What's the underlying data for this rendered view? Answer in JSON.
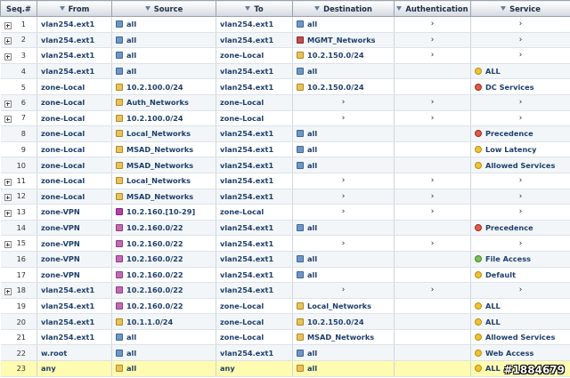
{
  "columns": {
    "seq": "Seq.#",
    "from": "From",
    "source": "Source",
    "to": "To",
    "destination": "Destination",
    "authentication": "Authentication",
    "service": "Service"
  },
  "rows": [
    {
      "seq": "1",
      "expandable": true,
      "from": "vlan254.ext1",
      "source": {
        "icon": "address",
        "text": "all"
      },
      "to": "vlan254.ext1",
      "destination": {
        "icon": "address",
        "text": "all"
      },
      "auth": "›",
      "service": {
        "icon": "",
        "text": "›"
      }
    },
    {
      "seq": "2",
      "expandable": true,
      "from": "vlan254.ext1",
      "source": {
        "icon": "address",
        "text": "all"
      },
      "to": "vlan254.ext1",
      "destination": {
        "icon": "mgmt",
        "text": "MGMT_Networks"
      },
      "auth": "›",
      "service": {
        "icon": "",
        "text": "›"
      }
    },
    {
      "seq": "3",
      "expandable": true,
      "from": "vlan254.ext1",
      "source": {
        "icon": "address",
        "text": "all"
      },
      "to": "zone-Local",
      "destination": {
        "icon": "group",
        "text": "10.2.150.0/24"
      },
      "auth": "›",
      "service": {
        "icon": "",
        "text": "›"
      }
    },
    {
      "seq": "4",
      "expandable": false,
      "from": "vlan254.ext1",
      "source": {
        "icon": "address",
        "text": "all"
      },
      "to": "vlan254.ext1",
      "destination": {
        "icon": "address",
        "text": "all"
      },
      "auth": "",
      "service": {
        "icon": "service",
        "text": "ALL"
      }
    },
    {
      "seq": "5",
      "expandable": false,
      "from": "zone-Local",
      "source": {
        "icon": "group",
        "text": "10.2.100.0/24"
      },
      "to": "vlan254.ext1",
      "destination": {
        "icon": "group",
        "text": "10.2.150.0/24"
      },
      "auth": "",
      "service": {
        "icon": "service-red",
        "text": "DC Services"
      }
    },
    {
      "seq": "6",
      "expandable": true,
      "from": "zone-Local",
      "source": {
        "icon": "group",
        "text": "Auth_Networks"
      },
      "to": "zone-Local",
      "destination": {
        "icon": "",
        "text": "›"
      },
      "auth": "›",
      "service": {
        "icon": "",
        "text": "›"
      }
    },
    {
      "seq": "7",
      "expandable": true,
      "from": "zone-Local",
      "source": {
        "icon": "group",
        "text": "10.2.100.0/24"
      },
      "to": "zone-Local",
      "destination": {
        "icon": "",
        "text": "›"
      },
      "auth": "›",
      "service": {
        "icon": "",
        "text": "›"
      }
    },
    {
      "seq": "8",
      "expandable": false,
      "from": "zone-Local",
      "source": {
        "icon": "group",
        "text": "Local_Networks"
      },
      "to": "vlan254.ext1",
      "destination": {
        "icon": "address",
        "text": "all"
      },
      "auth": "",
      "service": {
        "icon": "service-red",
        "text": "Precedence"
      }
    },
    {
      "seq": "9",
      "expandable": false,
      "from": "zone-Local",
      "source": {
        "icon": "group",
        "text": "MSAD_Networks"
      },
      "to": "vlan254.ext1",
      "destination": {
        "icon": "address",
        "text": "all"
      },
      "auth": "",
      "service": {
        "icon": "service",
        "text": "Low Latency"
      }
    },
    {
      "seq": "10",
      "expandable": false,
      "from": "zone-Local",
      "source": {
        "icon": "group",
        "text": "MSAD_Networks"
      },
      "to": "vlan254.ext1",
      "destination": {
        "icon": "address",
        "text": "all"
      },
      "auth": "",
      "service": {
        "icon": "service",
        "text": "Allowed Services"
      }
    },
    {
      "seq": "11",
      "expandable": true,
      "from": "zone-Local",
      "source": {
        "icon": "group",
        "text": "Local_Networks"
      },
      "to": "vlan254.ext1",
      "destination": {
        "icon": "",
        "text": "›"
      },
      "auth": "›",
      "service": {
        "icon": "",
        "text": "›"
      }
    },
    {
      "seq": "12",
      "expandable": true,
      "from": "zone-Local",
      "source": {
        "icon": "group",
        "text": "MSAD_Networks"
      },
      "to": "vlan254.ext1",
      "destination": {
        "icon": "",
        "text": "›"
      },
      "auth": "›",
      "service": {
        "icon": "",
        "text": "›"
      }
    },
    {
      "seq": "13",
      "expandable": true,
      "from": "zone-VPN",
      "source": {
        "icon": "range",
        "text": "10.2.160.[10-29]"
      },
      "to": "zone-Local",
      "destination": {
        "icon": "",
        "text": "›"
      },
      "auth": "›",
      "service": {
        "icon": "",
        "text": "›"
      }
    },
    {
      "seq": "14",
      "expandable": false,
      "from": "zone-VPN",
      "source": {
        "icon": "vip",
        "text": "10.2.160.0/22"
      },
      "to": "vlan254.ext1",
      "destination": {
        "icon": "address",
        "text": "all"
      },
      "auth": "",
      "service": {
        "icon": "service-red",
        "text": "Precedence"
      }
    },
    {
      "seq": "15",
      "expandable": true,
      "from": "zone-VPN",
      "source": {
        "icon": "vip",
        "text": "10.2.160.0/22"
      },
      "to": "vlan254.ext1",
      "destination": {
        "icon": "",
        "text": "›"
      },
      "auth": "›",
      "service": {
        "icon": "",
        "text": "›"
      }
    },
    {
      "seq": "16",
      "expandable": false,
      "from": "zone-VPN",
      "source": {
        "icon": "vip",
        "text": "10.2.160.0/22"
      },
      "to": "vlan254.ext1",
      "destination": {
        "icon": "address",
        "text": "all"
      },
      "auth": "",
      "service": {
        "icon": "service-green",
        "text": "File Access"
      }
    },
    {
      "seq": "17",
      "expandable": false,
      "from": "zone-VPN",
      "source": {
        "icon": "vip",
        "text": "10.2.160.0/22"
      },
      "to": "vlan254.ext1",
      "destination": {
        "icon": "address",
        "text": "all"
      },
      "auth": "",
      "service": {
        "icon": "service",
        "text": "Default"
      }
    },
    {
      "seq": "18",
      "expandable": true,
      "from": "vlan254.ext1",
      "source": {
        "icon": "vip",
        "text": "10.2.160.0/22"
      },
      "to": "vlan254.ext1",
      "destination": {
        "icon": "",
        "text": "›"
      },
      "auth": "›",
      "service": {
        "icon": "",
        "text": "›"
      }
    },
    {
      "seq": "19",
      "expandable": false,
      "from": "vlan254.ext1",
      "source": {
        "icon": "vip",
        "text": "10.2.160.0/22"
      },
      "to": "zone-Local",
      "destination": {
        "icon": "group",
        "text": "Local_Networks"
      },
      "auth": "",
      "service": {
        "icon": "service",
        "text": "ALL"
      }
    },
    {
      "seq": "20",
      "expandable": false,
      "from": "vlan254.ext1",
      "source": {
        "icon": "group",
        "text": "10.1.1.0/24"
      },
      "to": "zone-Local",
      "destination": {
        "icon": "group",
        "text": "10.2.150.0/24"
      },
      "auth": "",
      "service": {
        "icon": "service",
        "text": "ALL"
      }
    },
    {
      "seq": "21",
      "expandable": false,
      "from": "vlan254.ext1",
      "source": {
        "icon": "address",
        "text": "all"
      },
      "to": "zone-Local",
      "destination": {
        "icon": "group",
        "text": "MSAD_Networks"
      },
      "auth": "",
      "service": {
        "icon": "service",
        "text": "Allowed Services"
      }
    },
    {
      "seq": "22",
      "expandable": false,
      "from": "w.root",
      "source": {
        "icon": "address",
        "text": "all"
      },
      "to": "vlan254.ext1",
      "destination": {
        "icon": "address",
        "text": "all"
      },
      "auth": "",
      "service": {
        "icon": "service",
        "text": "Web Access"
      }
    },
    {
      "seq": "23",
      "expandable": false,
      "highlight": true,
      "from": "any",
      "source": {
        "icon": "group",
        "text": "all"
      },
      "to": "any",
      "destination": {
        "icon": "group",
        "text": "all"
      },
      "auth": "",
      "service": {
        "icon": "service",
        "text": "ALL"
      }
    }
  ],
  "watermark": "#1884679"
}
